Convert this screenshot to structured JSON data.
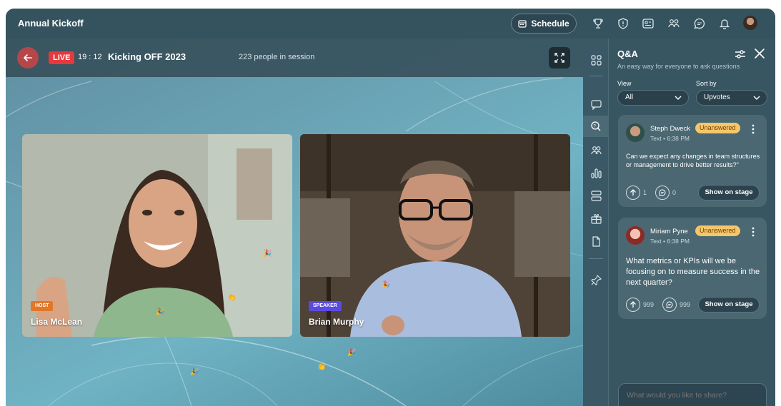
{
  "app": {
    "title": "Annual Kickoff"
  },
  "topbar": {
    "schedule_label": "Schedule",
    "icons": [
      "trophy-icon",
      "shield-icon",
      "agenda-icon",
      "people-icon",
      "chat-icon",
      "bell-icon"
    ]
  },
  "stage": {
    "live_label": "LIVE",
    "timer": "19 : 12",
    "session_title": "Kicking OFF 2023",
    "people_count": "223 people in session",
    "participants": [
      {
        "role": "HOST",
        "name": "Lisa McLean"
      },
      {
        "role": "SPEAKER",
        "name": "Brian Murphy"
      }
    ]
  },
  "panel": {
    "title": "Q&A",
    "subtitle": "An easy way for everyone to ask questions",
    "view_label": "View",
    "view_value": "All",
    "sort_label": "Sort by",
    "sort_value": "Upvotes",
    "questions": [
      {
        "author": "Steph Dweck",
        "meta": "Text  •  6:38 PM",
        "status": "Unanswered",
        "text": "Can we expect any changes in team structures or management to drive better results?\"",
        "upvotes": "1",
        "replies": "0",
        "action": "Show on stage"
      },
      {
        "author": "Miriam Pyne",
        "meta": "Text  •  6:38 PM",
        "status": "Unanswered",
        "text": "What metrics or KPIs will we be focusing on to measure success in the next quarter?",
        "upvotes": "999",
        "replies": "999",
        "action": "Show on stage"
      }
    ],
    "input_placeholder": "What would you like to share?"
  },
  "colors": {
    "live": "#e5393e",
    "host_badge": "#e0782b",
    "speaker_badge": "#5b4ae0",
    "status_badge": "#f6c66a",
    "panel_bg": "#385562"
  }
}
